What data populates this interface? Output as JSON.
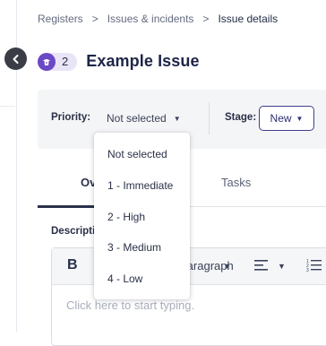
{
  "breadcrumb": {
    "items": [
      "Registers",
      "Issues & incidents"
    ],
    "current": "Issue details",
    "separator": ">"
  },
  "header": {
    "badge_icon": "issue-icon",
    "badge_count": "2",
    "title": "Example Issue"
  },
  "fields": {
    "priority_label": "Priority:",
    "priority_value": "Not selected",
    "stage_label": "Stage:",
    "stage_value": "New"
  },
  "tabs": [
    {
      "label": "Overview",
      "active": true
    },
    {
      "label": "Tasks",
      "active": false
    }
  ],
  "description": {
    "label": "Description",
    "toolbar": {
      "bold": "B",
      "paragraph": "Paragraph",
      "align_icon": "align-left-icon",
      "list_icon": "numbered-list-icon"
    },
    "placeholder": "Click here to start typing."
  },
  "priority_dropdown": {
    "options": [
      "Not selected",
      "1 - Immediate",
      "2 - High",
      "3 - Medium",
      "4 - Low"
    ]
  },
  "colors": {
    "accent": "#2d2f72",
    "badge_circle": "#6b48c6",
    "badge_bg": "#e9e4f6",
    "back_button": "#3a3d45"
  }
}
